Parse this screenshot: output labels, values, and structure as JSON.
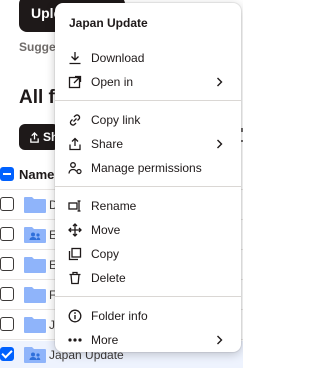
{
  "background": {
    "upload_label": "Upload",
    "suggested_label": "Suggested",
    "section_title": "All files",
    "share_label": "Share",
    "column_name": "Name",
    "rows": [
      {
        "name": "D",
        "checked": false,
        "shared": false
      },
      {
        "name": "E",
        "checked": false,
        "shared": true
      },
      {
        "name": "E",
        "checked": false,
        "shared": false
      },
      {
        "name": "F",
        "checked": false,
        "shared": false
      },
      {
        "name": "Ja",
        "checked": false,
        "shared": false
      },
      {
        "name": "Japan Update",
        "checked": true,
        "shared": true
      }
    ]
  },
  "menu": {
    "title": "Japan Update",
    "groups": [
      [
        {
          "label": "Download",
          "icon": "download-icon",
          "submenu": false
        },
        {
          "label": "Open in",
          "icon": "open-in-icon",
          "submenu": true
        }
      ],
      [
        {
          "label": "Copy link",
          "icon": "link-icon",
          "submenu": false
        },
        {
          "label": "Share",
          "icon": "share-icon",
          "submenu": true
        },
        {
          "label": "Manage permissions",
          "icon": "permissions-icon",
          "submenu": false
        }
      ],
      [
        {
          "label": "Rename",
          "icon": "rename-icon",
          "submenu": false
        },
        {
          "label": "Move",
          "icon": "move-icon",
          "submenu": false
        },
        {
          "label": "Copy",
          "icon": "copy-icon",
          "submenu": false
        },
        {
          "label": "Delete",
          "icon": "trash-icon",
          "submenu": false
        }
      ],
      [
        {
          "label": "Folder info",
          "icon": "info-icon",
          "submenu": false
        },
        {
          "label": "More",
          "icon": "more-icon",
          "submenu": true
        }
      ]
    ]
  },
  "colors": {
    "accent": "#0061fe",
    "folder": "#8fb4fa",
    "text": "#1e1919",
    "dark_button": "#1e1919"
  }
}
